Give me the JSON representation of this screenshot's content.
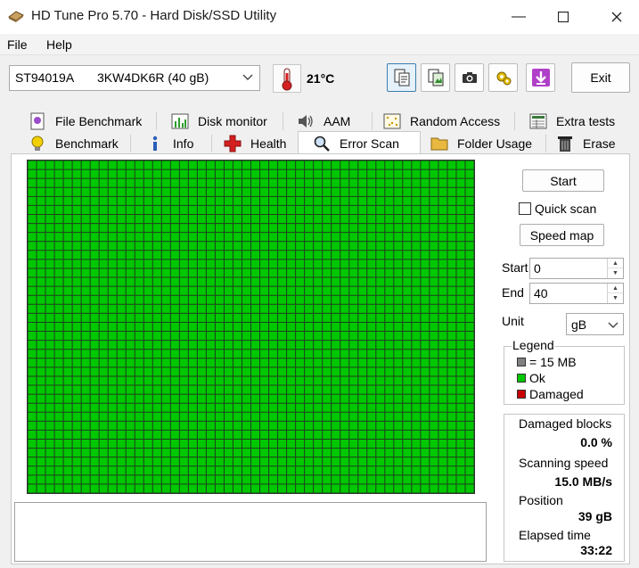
{
  "window": {
    "title": "HD Tune Pro 5.70 - Hard Disk/SSD Utility",
    "minimize_glyph": "—",
    "maximize_glyph": "☐",
    "close_glyph": "✕"
  },
  "menu": {
    "file": "File",
    "help": "Help"
  },
  "toolbar": {
    "drive_model": "ST94019A",
    "drive_serial": "3KW4DK6R (40 gB)",
    "temperature": "21°C",
    "buttons": [
      "copy-info-icon",
      "copy-screenshot-icon",
      "camera-icon",
      "gear-icon",
      "download-icon"
    ],
    "exit_label": "Exit"
  },
  "tabs_top": [
    {
      "label": "File Benchmark",
      "icon": "file-benchmark-icon"
    },
    {
      "label": "Disk monitor",
      "icon": "disk-monitor-icon"
    },
    {
      "label": "AAM",
      "icon": "speaker-icon"
    },
    {
      "label": "Random Access",
      "icon": "random-access-icon"
    },
    {
      "label": "Extra tests",
      "icon": "extra-tests-icon"
    }
  ],
  "tabs_bottom": [
    {
      "label": "Benchmark",
      "icon": "benchmark-icon"
    },
    {
      "label": "Info",
      "icon": "info-icon"
    },
    {
      "label": "Health",
      "icon": "health-cross-icon"
    },
    {
      "label": "Error Scan",
      "icon": "magnifier-icon",
      "selected": true
    },
    {
      "label": "Folder Usage",
      "icon": "folder-icon"
    },
    {
      "label": "Erase",
      "icon": "trash-icon"
    }
  ],
  "scan": {
    "grid_block_status": "ok",
    "start_label": "Start",
    "quick_scan_label": "Quick scan",
    "quick_scan_checked": false,
    "speed_map_label": "Speed map",
    "range_start_label": "Start",
    "range_start_value": "0",
    "range_end_label": "End",
    "range_end_value": "40",
    "unit_label": "Unit",
    "unit_value": "gB"
  },
  "legend": {
    "title": "Legend",
    "items": [
      {
        "label": "= 15 MB",
        "color": "#808080"
      },
      {
        "label": "Ok",
        "color": "#00c800"
      },
      {
        "label": "Damaged",
        "color": "#c80000"
      }
    ]
  },
  "stats": {
    "damaged_blocks_label": "Damaged blocks",
    "damaged_blocks_value": "0.0 %",
    "scanning_speed_label": "Scanning speed",
    "scanning_speed_value": "15.0 MB/s",
    "position_label": "Position",
    "position_value": "39 gB",
    "elapsed_time_label": "Elapsed time",
    "elapsed_time_value": "33:22"
  },
  "log_text": ""
}
